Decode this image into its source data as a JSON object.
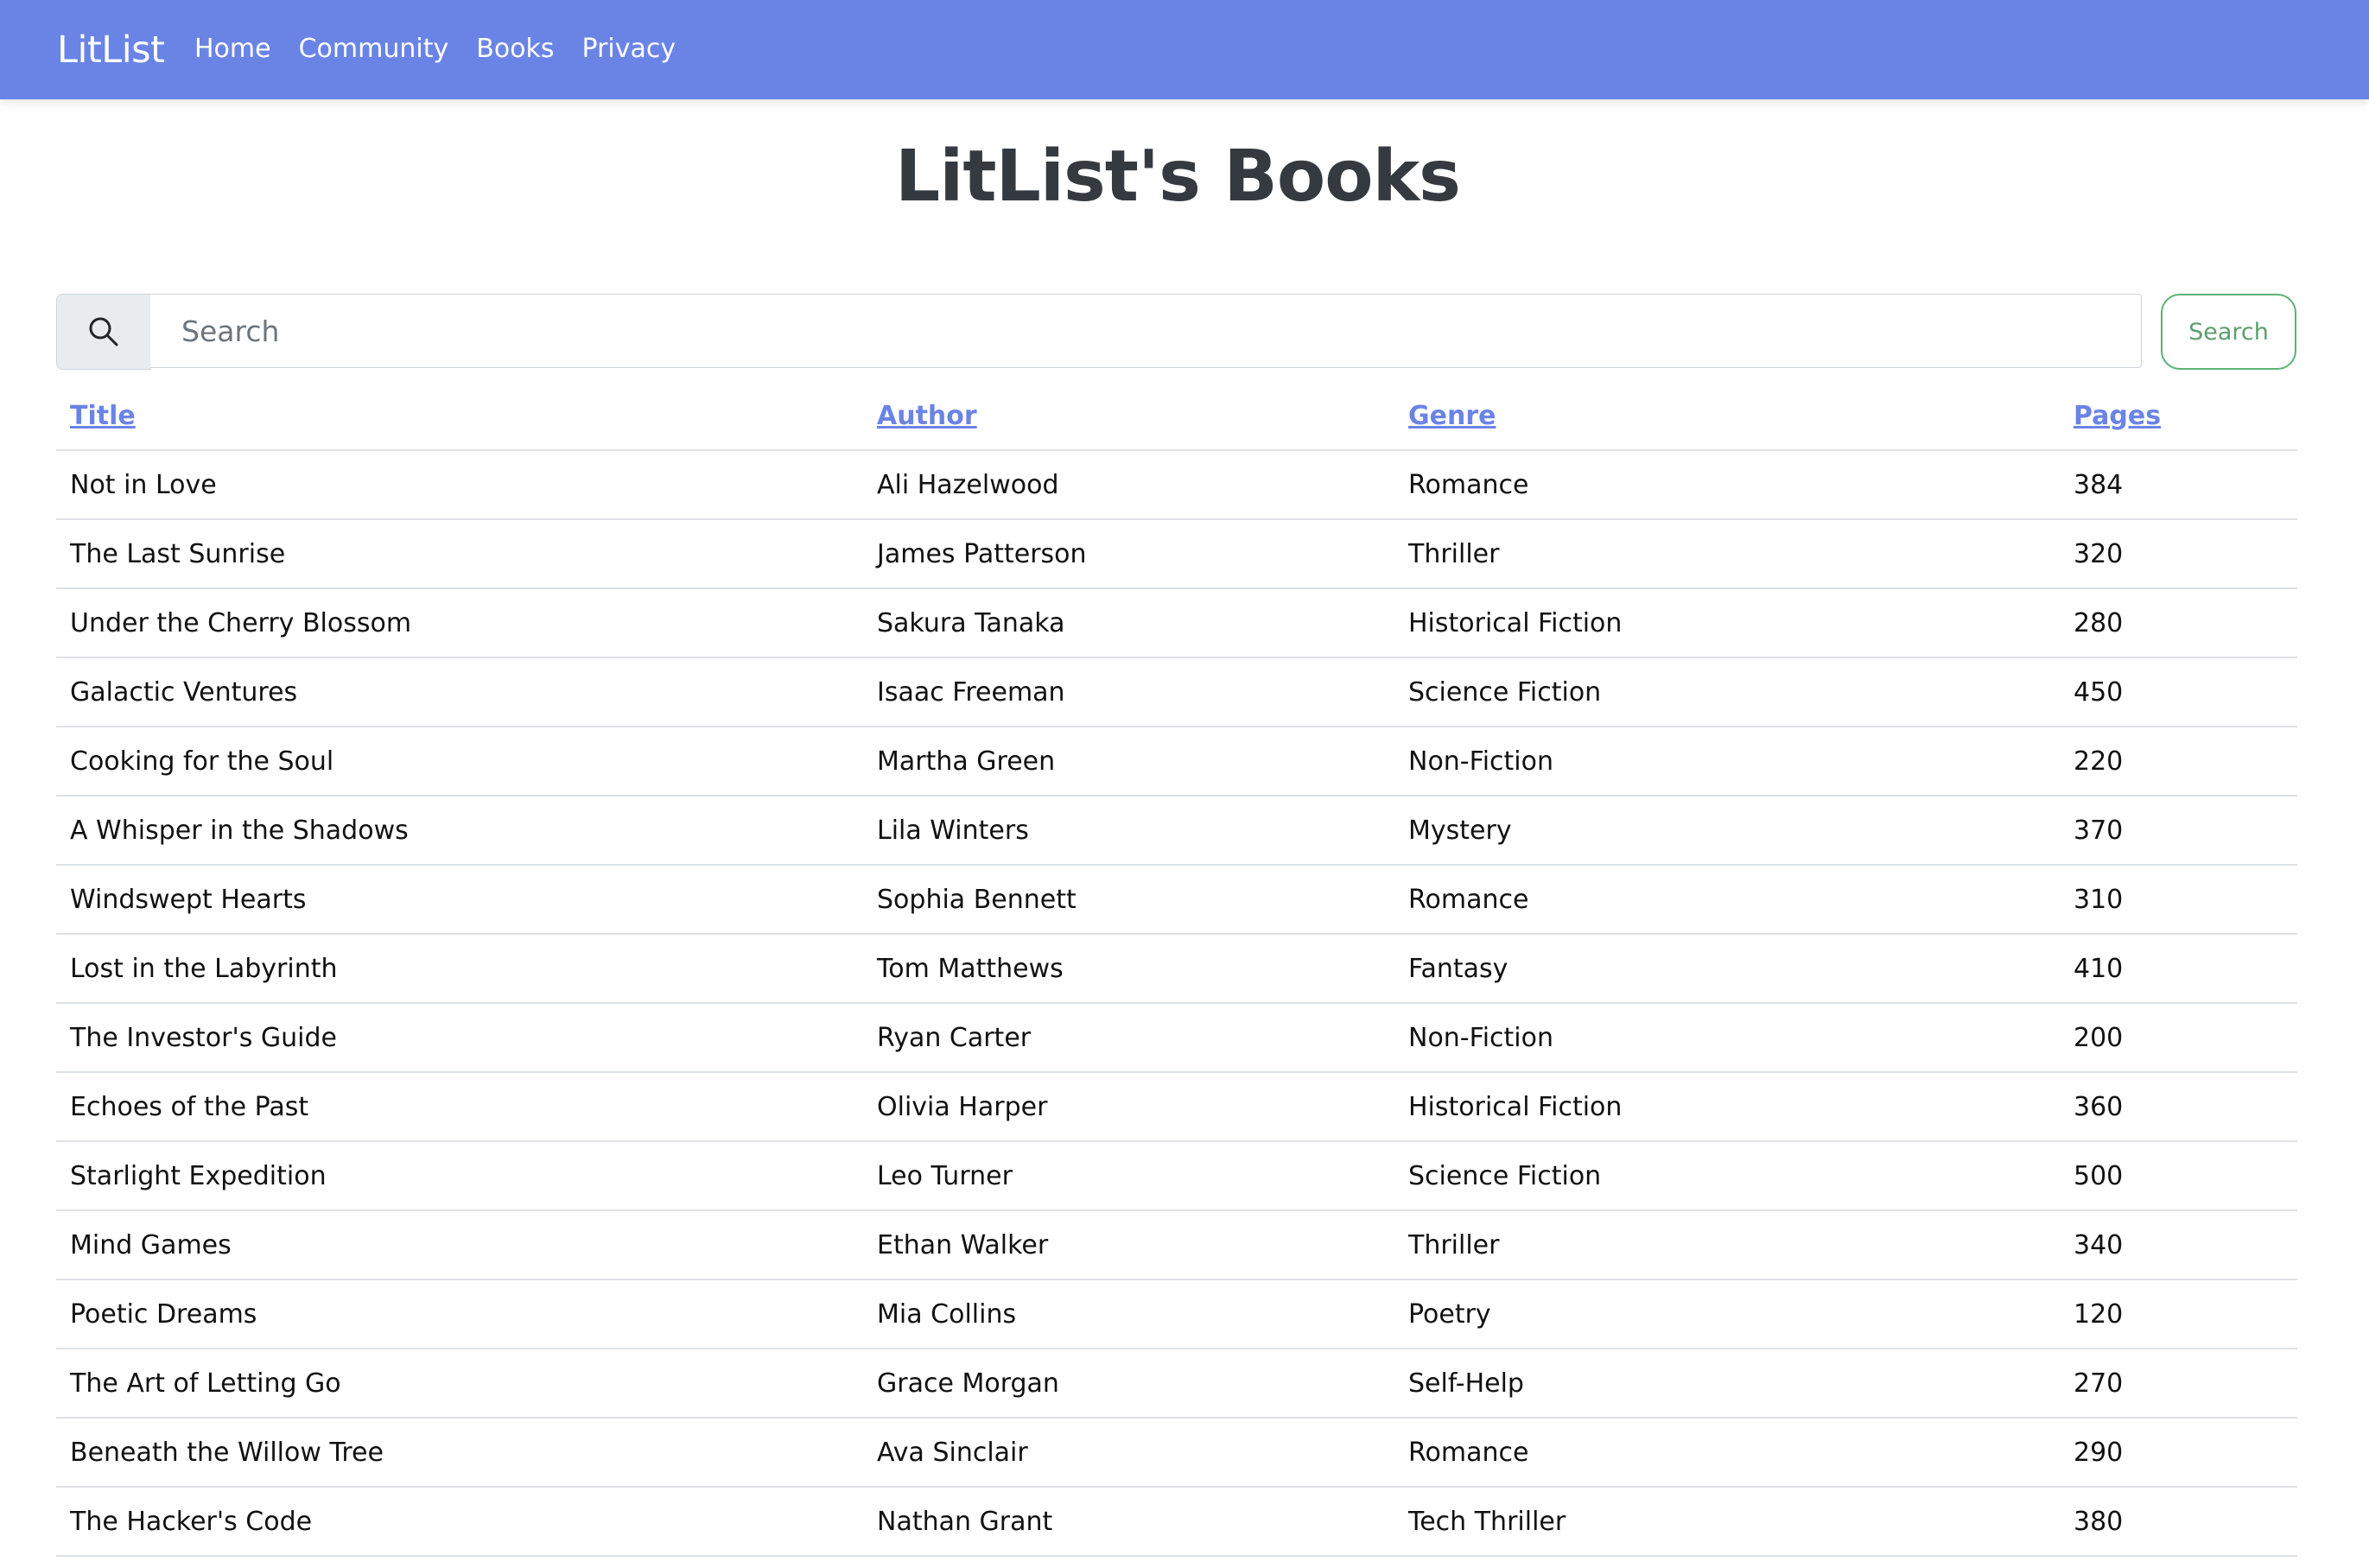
{
  "navbar": {
    "brand": "LitList",
    "links": [
      "Home",
      "Community",
      "Books",
      "Privacy"
    ],
    "color": "#6a84e6"
  },
  "page": {
    "title": "LitList's Books"
  },
  "search": {
    "icon": "search-icon",
    "placeholder": "Search",
    "value": "",
    "button_label": "Search",
    "button_color": "#5cb276"
  },
  "table": {
    "headers": [
      "Title",
      "Author",
      "Genre",
      "Pages"
    ],
    "rows": [
      [
        "Not in Love",
        "Ali Hazelwood",
        "Romance",
        "384"
      ],
      [
        "The Last Sunrise",
        "James Patterson",
        "Thriller",
        "320"
      ],
      [
        "Under the Cherry Blossom",
        "Sakura Tanaka",
        "Historical Fiction",
        "280"
      ],
      [
        "Galactic Ventures",
        "Isaac Freeman",
        "Science Fiction",
        "450"
      ],
      [
        "Cooking for the Soul",
        "Martha Green",
        "Non-Fiction",
        "220"
      ],
      [
        "A Whisper in the Shadows",
        "Lila Winters",
        "Mystery",
        "370"
      ],
      [
        "Windswept Hearts",
        "Sophia Bennett",
        "Romance",
        "310"
      ],
      [
        "Lost in the Labyrinth",
        "Tom Matthews",
        "Fantasy",
        "410"
      ],
      [
        "The Investor's Guide",
        "Ryan Carter",
        "Non-Fiction",
        "200"
      ],
      [
        "Echoes of the Past",
        "Olivia Harper",
        "Historical Fiction",
        "360"
      ],
      [
        "Starlight Expedition",
        "Leo Turner",
        "Science Fiction",
        "500"
      ],
      [
        "Mind Games",
        "Ethan Walker",
        "Thriller",
        "340"
      ],
      [
        "Poetic Dreams",
        "Mia Collins",
        "Poetry",
        "120"
      ],
      [
        "The Art of Letting Go",
        "Grace Morgan",
        "Self-Help",
        "270"
      ],
      [
        "Beneath the Willow Tree",
        "Ava Sinclair",
        "Romance",
        "290"
      ],
      [
        "The Hacker's Code",
        "Nathan Grant",
        "Tech Thriller",
        "380"
      ]
    ]
  }
}
